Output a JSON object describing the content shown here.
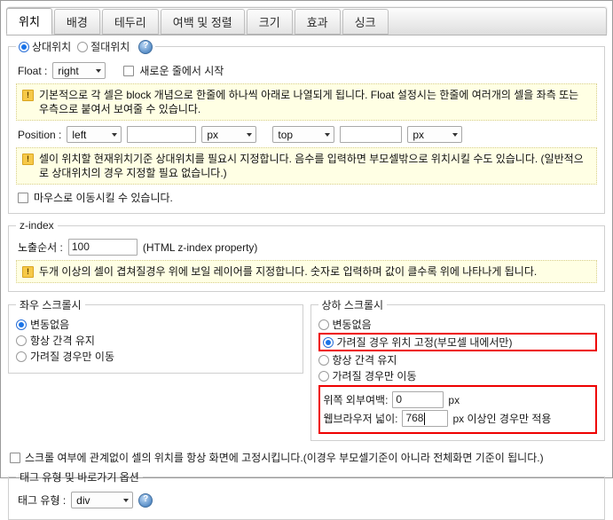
{
  "tabs": [
    {
      "label": "위치",
      "active": true
    },
    {
      "label": "배경",
      "active": false
    },
    {
      "label": "테두리",
      "active": false
    },
    {
      "label": "여백 및 정렬",
      "active": false
    },
    {
      "label": "크기",
      "active": false
    },
    {
      "label": "효과",
      "active": false
    },
    {
      "label": "싱크",
      "active": false
    }
  ],
  "position_section": {
    "legend_relative": "상대위치",
    "legend_absolute": "절대위치",
    "help_icon": "question-mark-icon",
    "help_label": "?",
    "float_label": "Float :",
    "float_value": "right",
    "newline_checkbox_label": "새로운 줄에서 시작",
    "notice_float": "기본적으로 각 셀은 block 개념으로 한줄에 하나씩 아래로 나열되게 됩니다. Float 설정시는 한줄에 여러개의 셀을 좌측 또는 우측으로 붙여서 보여줄 수 있습니다.",
    "position_label": "Position :",
    "pos_x_side": "left",
    "pos_x_value": "",
    "pos_x_unit": "px",
    "pos_y_side": "top",
    "pos_y_value": "",
    "pos_y_unit": "px",
    "notice_position": "셀이 위치할 현재위치기준 상대위치를 필요시 지정합니다. 음수를 입력하면 부모셀밖으로 위치시킬 수도 있습니다. (일반적으로 상대위치의 경우 지정할 필요 없습니다.)",
    "mouse_move_checkbox_label": "마우스로 이동시킬 수 있습니다."
  },
  "zindex_section": {
    "legend": "z-index",
    "order_label": "노출순서 :",
    "order_value": "100",
    "property_hint": "(HTML z-index property)",
    "notice": "두개 이상의 셀이 겹쳐질경우 위에 보일 레이어를 지정합니다. 숫자로 입력하며 값이 클수록 위에 나타나게 됩니다."
  },
  "horizontal_scroll": {
    "legend": "좌우 스크롤시",
    "options": [
      {
        "label": "변동없음",
        "selected": true
      },
      {
        "label": "항상 간격 유지",
        "selected": false
      },
      {
        "label": "가려질 경우만 이동",
        "selected": false
      }
    ]
  },
  "vertical_scroll": {
    "legend": "상하 스크롤시",
    "options": [
      {
        "label": "변동없음",
        "selected": false,
        "highlighted": false
      },
      {
        "label": "가려질 경우 위치 고정(부모셀 내에서만)",
        "selected": true,
        "highlighted": true
      },
      {
        "label": "항상 간격 유지",
        "selected": false,
        "highlighted": false
      },
      {
        "label": "가려질 경우만 이동",
        "selected": false,
        "highlighted": false
      }
    ],
    "top_margin_label": "위쪽 외부여백:",
    "top_margin_value": "0",
    "top_margin_unit": "px",
    "browser_width_label": "웹브라우저 넓이:",
    "browser_width_value": "768",
    "browser_width_suffix": "px 이상인 경우만 적용"
  },
  "always_fixed": {
    "checkbox_label": "스크롤 여부에 관계없이 셀의 위치를 항상 화면에 고정시킵니다.(이경우 부모셀기준이 아니라 전체화면 기준이 됩니다.)"
  },
  "tag_section": {
    "legend": "태그 유형 및 바로가기 옵션",
    "tag_type_label": "태그 유형 :",
    "tag_type_value": "div"
  },
  "colors": {
    "highlight": "#ee0000",
    "radio_accent": "#1a73e8",
    "notice_bg": "#ffffe4",
    "notice_border": "#d8cf8c"
  }
}
